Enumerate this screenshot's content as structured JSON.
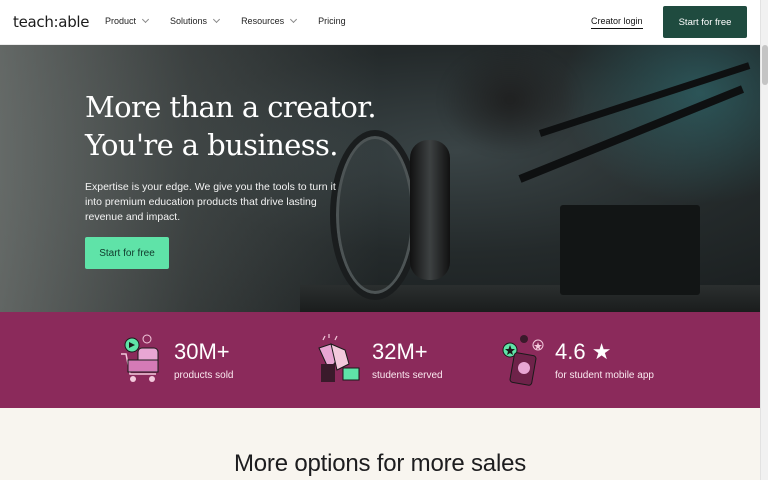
{
  "nav": {
    "logo": "teach:able",
    "items": [
      {
        "label": "Product",
        "dropdown": true
      },
      {
        "label": "Solutions",
        "dropdown": true
      },
      {
        "label": "Resources",
        "dropdown": true
      },
      {
        "label": "Pricing",
        "dropdown": false
      }
    ],
    "login": "Creator login",
    "cta": "Start for free"
  },
  "hero": {
    "title_line1": "More than a creator.",
    "title_line2": "You're a business.",
    "text": "Expertise is your edge. We give you the tools to turn it into premium education products that drive lasting revenue and impact.",
    "cta": "Start for free"
  },
  "stats": [
    {
      "number": "30M+",
      "label": "products sold",
      "icon": "shopping-cart-icon"
    },
    {
      "number": "32M+",
      "label": "students served",
      "icon": "clapping-hands-icon"
    },
    {
      "number": "4.6 ★",
      "label": "for student mobile app",
      "icon": "phone-rating-icon"
    }
  ],
  "section": {
    "title": "More options for more sales"
  },
  "colors": {
    "brand_dark_green": "#1f4b3f",
    "mint": "#5fe3a8",
    "stats_band": "#8b2a5b",
    "cream": "#f8f5ef"
  }
}
